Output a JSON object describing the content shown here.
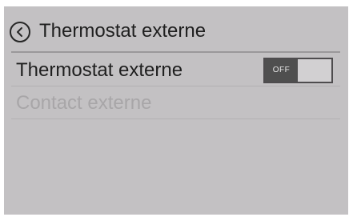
{
  "header": {
    "back_icon": "chevron-left-circle-icon",
    "title": "Thermostat externe"
  },
  "settings": [
    {
      "label": "Thermostat externe",
      "enabled": true,
      "toggle": {
        "state": "OFF",
        "on": false
      }
    },
    {
      "label": "Contact externe",
      "enabled": false
    }
  ],
  "colors": {
    "screen_background": "#c3c1c3",
    "text_primary": "#1f1f1f",
    "text_disabled": "#a8a6a8",
    "toggle_knob": "#4f4f4f"
  }
}
